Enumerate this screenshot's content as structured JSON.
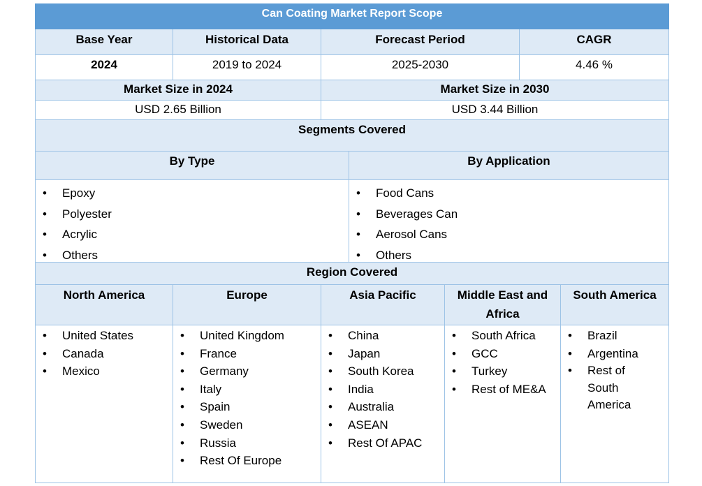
{
  "title": "Can Coating Market Report Scope",
  "row1": {
    "headers": [
      "Base Year",
      "Historical Data",
      "Forecast Period",
      "CAGR"
    ],
    "values": [
      "2024",
      "2019 to 2024",
      "2025-2030",
      "4.46 %"
    ]
  },
  "market": {
    "h1": "Market Size in 2024",
    "h2": "Market Size in 2030",
    "v1": "USD 2.65 Billion",
    "v2": "USD 3.44 Billion"
  },
  "segments": {
    "title": "Segments Covered",
    "by_type": {
      "header": "By Type",
      "items": [
        "Epoxy",
        "Polyester",
        "Acrylic",
        "Others"
      ]
    },
    "by_application": {
      "header": "By Application",
      "items": [
        "Food Cans",
        "Beverages Can",
        "Aerosol Cans",
        "Others"
      ]
    }
  },
  "region": {
    "title": "Region Covered",
    "columns": [
      {
        "header": "North America",
        "items": [
          "United States",
          "Canada",
          "Mexico"
        ]
      },
      {
        "header": "Europe",
        "items": [
          "United Kingdom",
          "France",
          "Germany",
          "Italy",
          "Spain",
          "Sweden",
          "Russia",
          "Rest Of Europe"
        ]
      },
      {
        "header": "Asia Pacific",
        "items": [
          "China",
          "Japan",
          "South Korea",
          "India",
          "Australia",
          "ASEAN",
          "Rest Of APAC"
        ]
      },
      {
        "header": "Middle East and Africa",
        "items": [
          "South Africa",
          "GCC",
          "Turkey",
          "Rest of ME&A"
        ]
      },
      {
        "header": "South America",
        "items": [
          "Brazil",
          "Argentina",
          "Rest of South America"
        ]
      }
    ]
  },
  "colors": {
    "title_bg": "#5b9bd5",
    "header_bg": "#deeaf6",
    "border": "#9dc3e6"
  }
}
